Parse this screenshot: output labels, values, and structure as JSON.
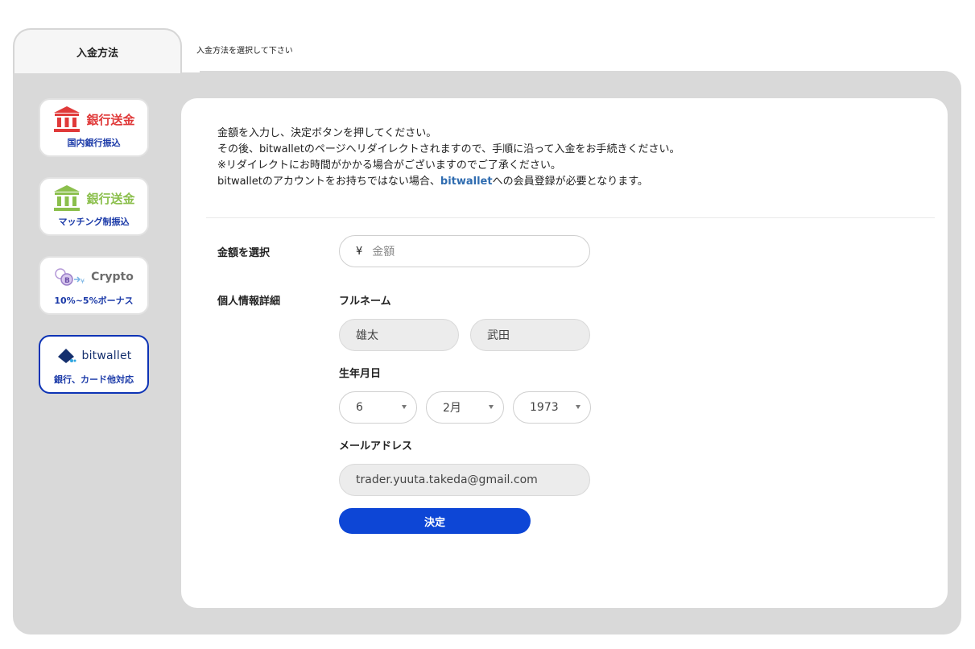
{
  "tab": {
    "active_label": "入金方法",
    "hint": "入金方法を選択して下さい"
  },
  "methods": [
    {
      "title": "銀行送金",
      "subtitle": "国内銀行振込",
      "icon": "bank-icon",
      "color": "#e03a3a"
    },
    {
      "title": "銀行送金",
      "subtitle": "マッチング制振込",
      "icon": "bank-icon",
      "color": "#8bbf4c"
    },
    {
      "title": "Crypto",
      "subtitle": "10%~5%ボーナス",
      "icon": "crypto-icon",
      "color": "#6c6c6c"
    },
    {
      "title": "bitwallet",
      "subtitle": "銀行、カード他対応",
      "icon": "bitwallet-logo-icon",
      "color": "#15306e",
      "selected": true
    }
  ],
  "intro": {
    "line1": "金額を入力し、決定ボタンを押してください。",
    "line2": "その後、bitwalletのページへリダイレクトされますので、手順に沿って入金をお手続きください。",
    "line3": "※リダイレクトにお時間がかかる場合がございますのでご了承ください。",
    "line4_pre": "bitwalletのアカウントをお持ちではない場合、",
    "line4_link": "bitwallet",
    "line4_post": "への会員登録が必要となります。"
  },
  "form": {
    "amount_label": "金額を選択",
    "currency_symbol": "¥",
    "amount_placeholder": "金額",
    "personal_label": "個人情報詳細",
    "fullname_label": "フルネーム",
    "first_name": "雄太",
    "last_name": "武田",
    "dob_label": "生年月日",
    "dob_day": "6",
    "dob_month": "2月",
    "dob_year": "1973",
    "email_label": "メールアドレス",
    "email": "trader.yuuta.takeda@gmail.com",
    "submit_label": "決定"
  },
  "colors": {
    "accent": "#0d46d6",
    "selected_border": "#0d33b5",
    "panel": "#d9d9d9"
  }
}
